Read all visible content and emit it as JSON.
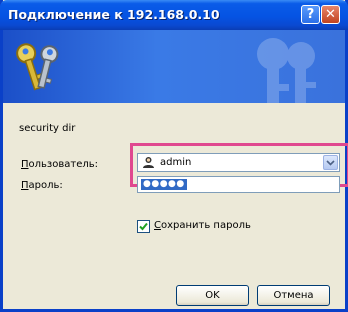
{
  "window": {
    "title": "Подключение к 192.168.0.10",
    "help_label": "?",
    "close_label": "✕"
  },
  "realm": "security dir",
  "fields": {
    "user_label_prefix": "",
    "user_label_accel": "П",
    "user_label_rest": "ользователь:",
    "user_value": "admin",
    "password_label_accel": "П",
    "password_label_rest": "ароль:",
    "password_value": "●●●●●"
  },
  "remember": {
    "checked": true,
    "label_prefix": "",
    "label_accel": "С",
    "label_rest": "охранить пароль"
  },
  "buttons": {
    "ok_label": "OK",
    "cancel_label": "Отмена"
  },
  "colors": {
    "titlebar": "#0553e3",
    "highlight": "#e0488f",
    "dialog_bg": "#ece9d8"
  },
  "icons": [
    "keys-icon",
    "help-icon",
    "close-icon",
    "user-icon",
    "chevron-down-icon",
    "checkmark-icon"
  ]
}
